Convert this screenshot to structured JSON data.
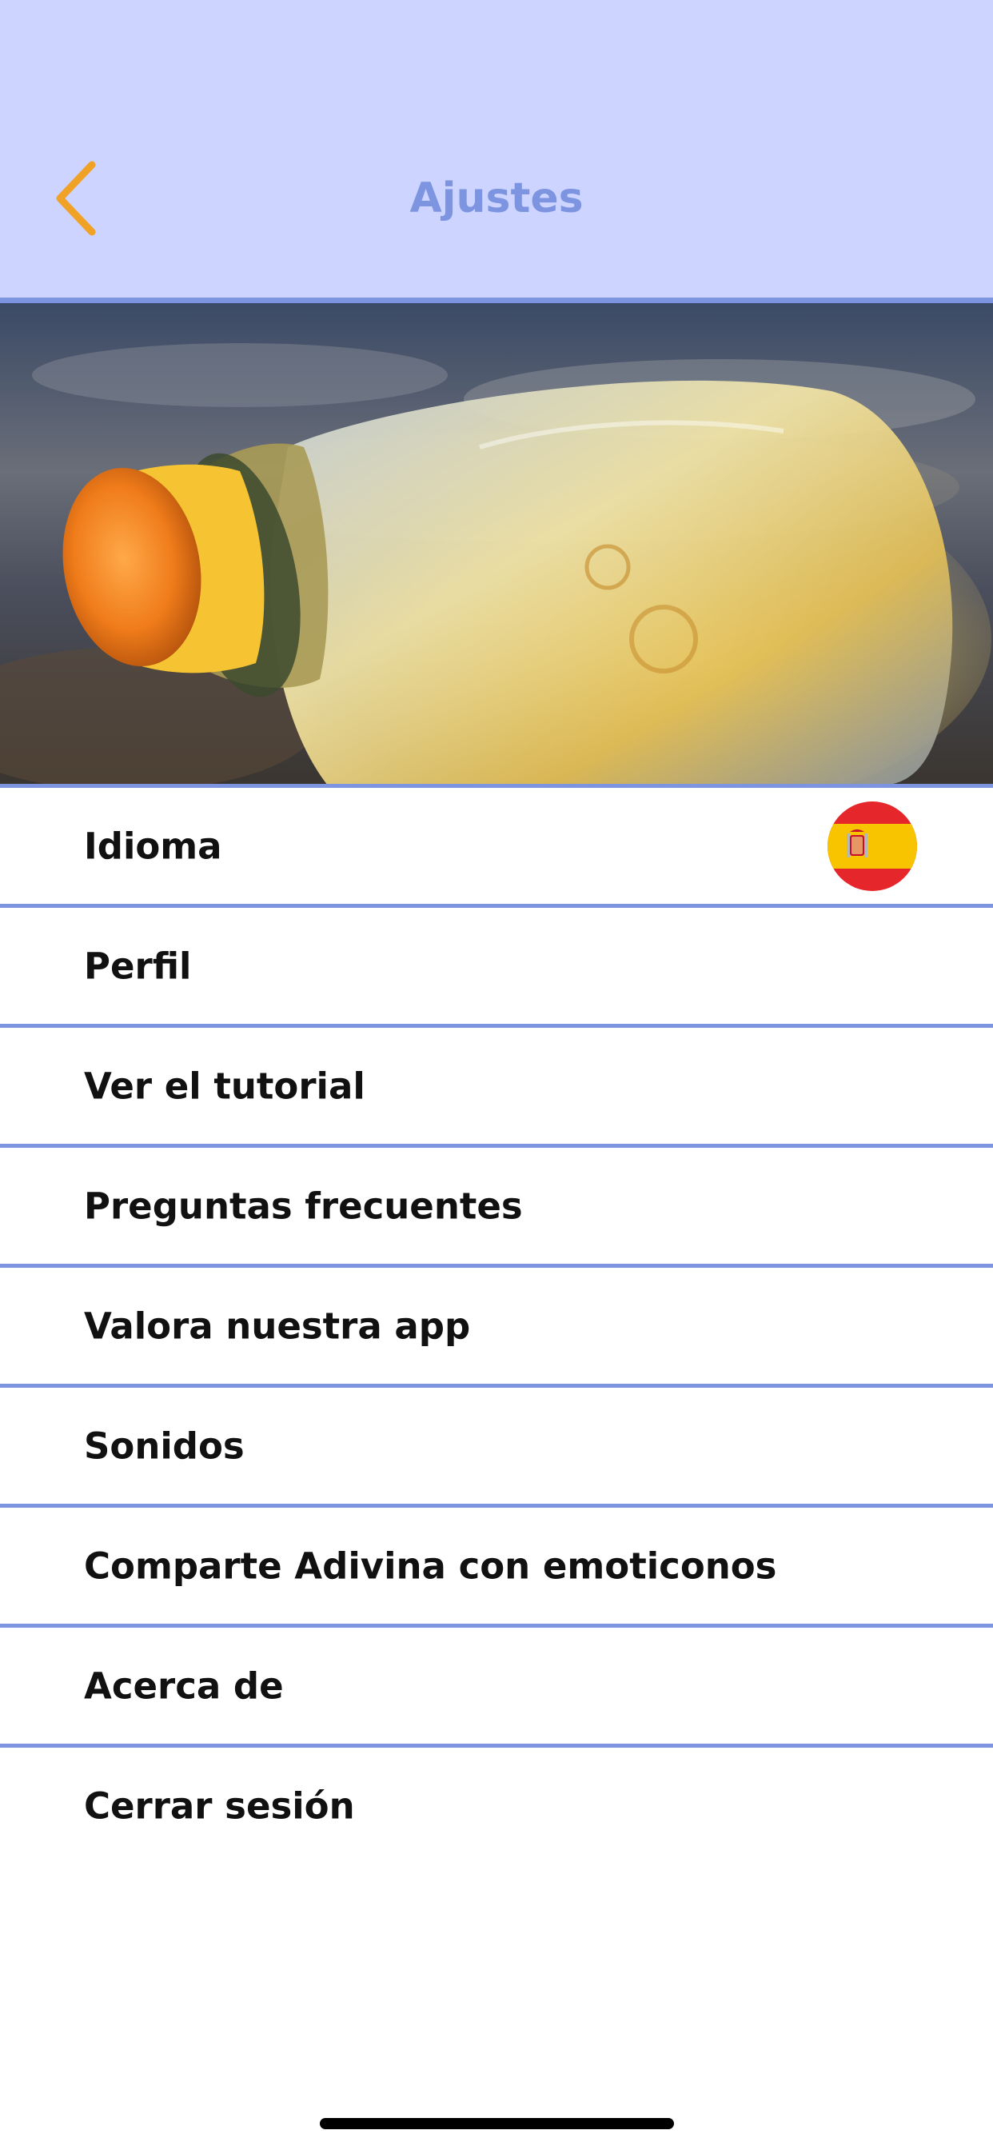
{
  "header": {
    "title": "Ajustes",
    "back_icon": "chevron-left-icon",
    "background_color": "#ccd4ff",
    "accent_color": "#7d95e0",
    "back_icon_color": "#f0a226"
  },
  "hero": {
    "image_subject": "message-in-a-bottle"
  },
  "menu": {
    "items": [
      {
        "label": "Idioma",
        "trailing_icon": "spain-flag-icon"
      },
      {
        "label": "Perfil"
      },
      {
        "label": "Ver el tutorial"
      },
      {
        "label": "Preguntas frecuentes"
      },
      {
        "label": "Valora nuestra app"
      },
      {
        "label": "Sonidos"
      },
      {
        "label": "Comparte Adivina con emoticonos"
      },
      {
        "label": "Acerca de"
      },
      {
        "label": "Cerrar sesión"
      }
    ],
    "divider_color": "#7d95e0"
  }
}
